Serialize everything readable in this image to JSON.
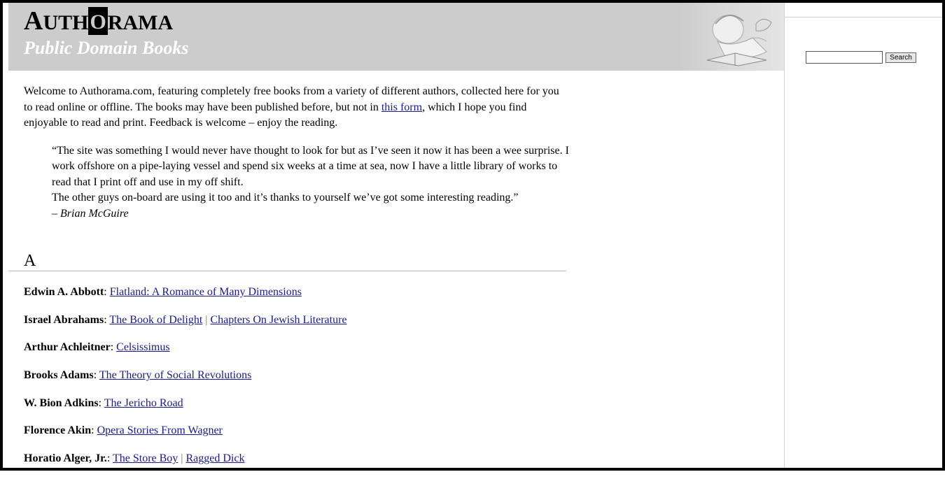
{
  "header": {
    "logo": {
      "a": "A",
      "uth": "UTH",
      "o": "O",
      "rama": "RAMA"
    },
    "tagline": "Public Domain Books"
  },
  "search": {
    "button_label": "Search",
    "value": ""
  },
  "intro": {
    "before_link": "Welcome to Authorama.com, featuring completely free books from a variety of different authors, collected here for you to read online or offline. The books may have been published before, but not in ",
    "link": "this form",
    "after_link": ", which I hope you find enjoyable to read and print. Feedback is welcome – enjoy the reading."
  },
  "quote": {
    "line1": "“The site was something I would never have thought to look for but as I’ve seen it now it has been a wee surprise. I work offshore on a pipe-laying vessel and spend six weeks at a time at sea, now I have a little library of works to read that I print off and use in my off shift.",
    "line2": "The other guys on-board are using it too and it’s thanks to yourself we’ve got some interesting reading.”",
    "author": "– Brian McGuire"
  },
  "section": {
    "letter": "A"
  },
  "authors": [
    {
      "name": "Edwin A. Abbott",
      "books": [
        "Flatland: A Romance of Many Dimensions"
      ]
    },
    {
      "name": "Israel Abrahams",
      "books": [
        "The Book of Delight",
        "Chapters On Jewish Literature"
      ]
    },
    {
      "name": "Arthur Achleitner",
      "books": [
        "Celsissimus"
      ]
    },
    {
      "name": "Brooks Adams",
      "books": [
        "The Theory of Social Revolutions"
      ]
    },
    {
      "name": "W. Bion Adkins",
      "books": [
        "The Jericho Road"
      ]
    },
    {
      "name": "Florence Akin",
      "books": [
        "Opera Stories From Wagner"
      ]
    },
    {
      "name": "Horatio Alger, Jr.",
      "books": [
        "The Store Boy",
        "Ragged Dick"
      ]
    }
  ],
  "colors": {
    "header_bg": "#cccccc",
    "link": "#1a1a8c"
  }
}
